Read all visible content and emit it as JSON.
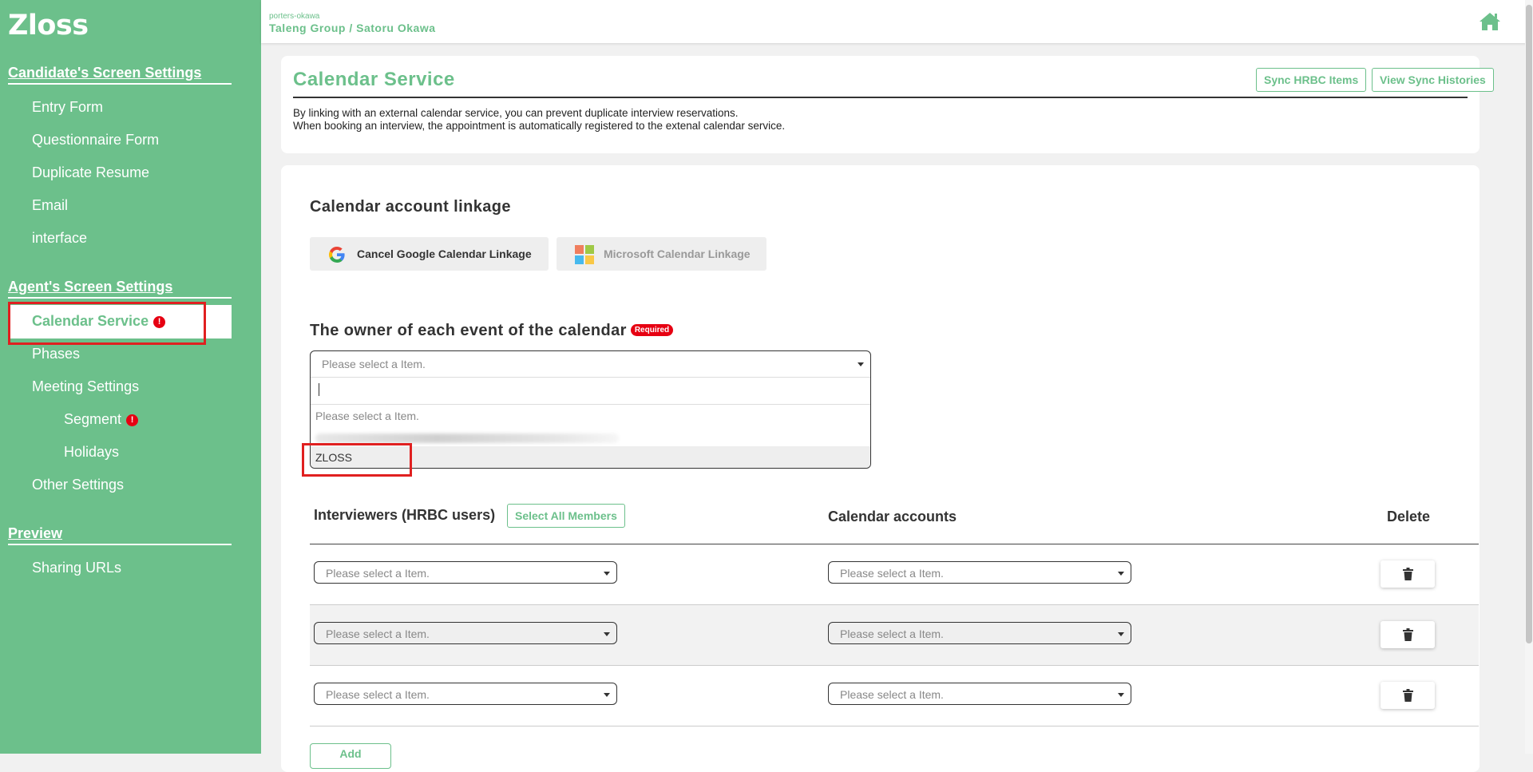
{
  "sidebar": {
    "logo": "Zloss",
    "sections": [
      {
        "title": "Candidate's Screen Settings",
        "items": [
          "Entry Form",
          "Questionnaire Form",
          "Duplicate Resume",
          "Email",
          "interface"
        ]
      },
      {
        "title": "Agent's Screen Settings",
        "items": [
          "Calendar Service",
          "Phases",
          "Meeting Settings",
          "Segment",
          "Holidays",
          "Other Settings"
        ]
      },
      {
        "title": "Preview",
        "items": [
          "Sharing URLs"
        ]
      }
    ],
    "alert_glyph": "!"
  },
  "header": {
    "org_small": "porters-okawa",
    "org_main": "Taleng Group / Satoru Okawa"
  },
  "page": {
    "title": "Calendar Service",
    "sync_button": "Sync HRBC Items",
    "view_sync_button": "View Sync Histories",
    "desc_line1": "By linking with an external calendar service, you can prevent duplicate interview reservations.",
    "desc_line2": "When booking an interview, the appointment is automatically registered to the extenal calendar service."
  },
  "linkage": {
    "title": "Calendar account linkage",
    "google_button": "Cancel Google Calendar Linkage",
    "microsoft_button": "Microsoft Calendar Linkage"
  },
  "owner": {
    "title": "The owner of each event of the calendar",
    "required_badge": "Required",
    "placeholder": "Please select a Item.",
    "options": [
      "Please select a Item.",
      "ZLOSS"
    ]
  },
  "table": {
    "col_interviewers": "Interviewers (HRBC users)",
    "select_all": "Select All Members",
    "col_calendar": "Calendar accounts",
    "col_delete": "Delete",
    "placeholder": "Please select a Item.",
    "add_button": "Add"
  },
  "colors": {
    "brand_green": "#6cc08b",
    "alert_red": "#e60012",
    "highlight_red": "#e02020"
  }
}
